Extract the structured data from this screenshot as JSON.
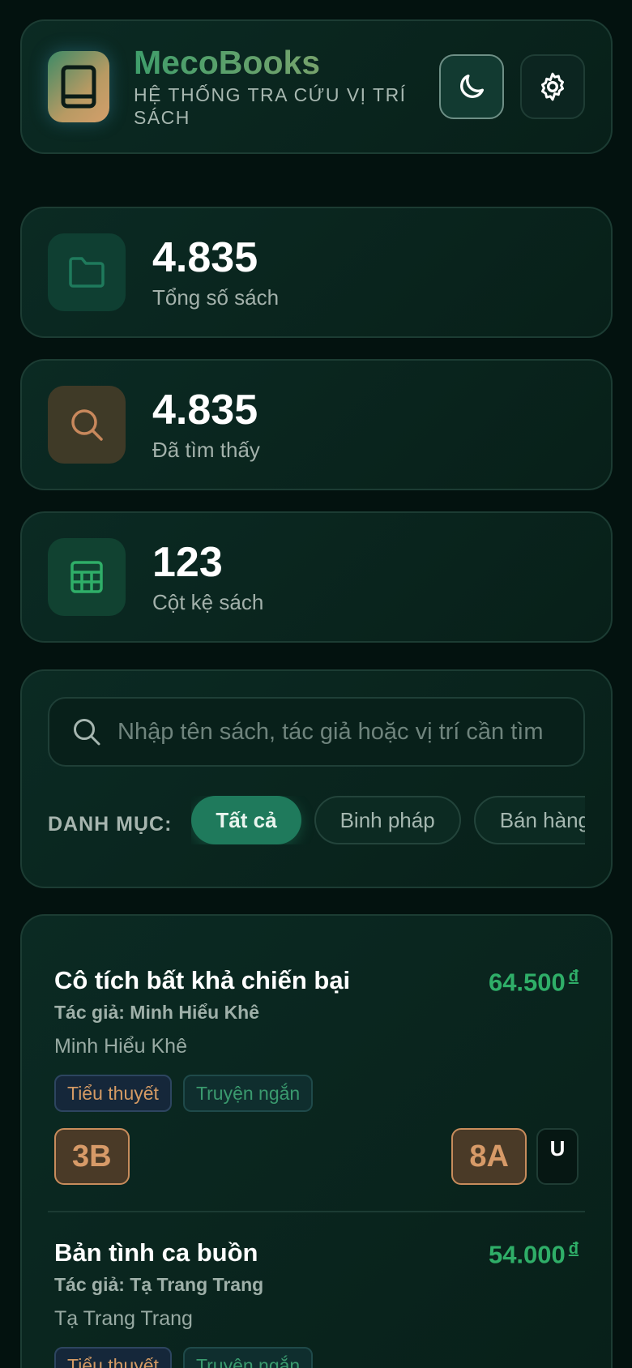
{
  "header": {
    "title": "MecoBooks",
    "subtitle": "HỆ THỐNG TRA CỨU VỊ TRÍ SÁCH",
    "icons": {
      "logo": "book-icon",
      "theme": "moon-icon",
      "settings": "gear-icon"
    }
  },
  "stats": [
    {
      "value": "4.835",
      "label": "Tổng số sách",
      "icon": "folder-icon",
      "color": "#1f7a5c"
    },
    {
      "value": "4.835",
      "label": "Đã tìm thấy",
      "icon": "search-icon",
      "color": "#c8885c"
    },
    {
      "value": "123",
      "label": "Cột kệ sách",
      "icon": "grid-icon",
      "color": "#2fae68"
    }
  ],
  "search": {
    "placeholder": "Nhập tên sách, tác giả hoặc vị trí cần tìm",
    "value": "",
    "category_label": "DANH MỤC:",
    "categories": [
      "Tất cả",
      "Binh pháp",
      "Bán hàng"
    ],
    "selected": "Tất cả"
  },
  "books": [
    {
      "title": "Cô tích bất khả chiến bại",
      "price": "64.500",
      "currency": "đ",
      "author_line": "Tác giả: Minh Hiểu Khê",
      "author": "Minh Hiểu Khê",
      "tags": [
        "Tiểu thuyết",
        "Truyện ngắn"
      ],
      "shelf_left": "3B",
      "shelf_right": "8A",
      "shelf_extra": "U"
    },
    {
      "title": "Bản tình ca buồn",
      "price": "54.000",
      "currency": "đ",
      "author_line": "Tác giả: Tạ Trang Trang",
      "author": "Tạ Trang Trang",
      "tags": [
        "Tiểu thuyết",
        "Truyện ngắn"
      ]
    }
  ],
  "colors": {
    "background": "#03120f",
    "accent_green": "#1f7a5c",
    "price_green": "#2fae68",
    "accent_orange": "#c8885c"
  }
}
